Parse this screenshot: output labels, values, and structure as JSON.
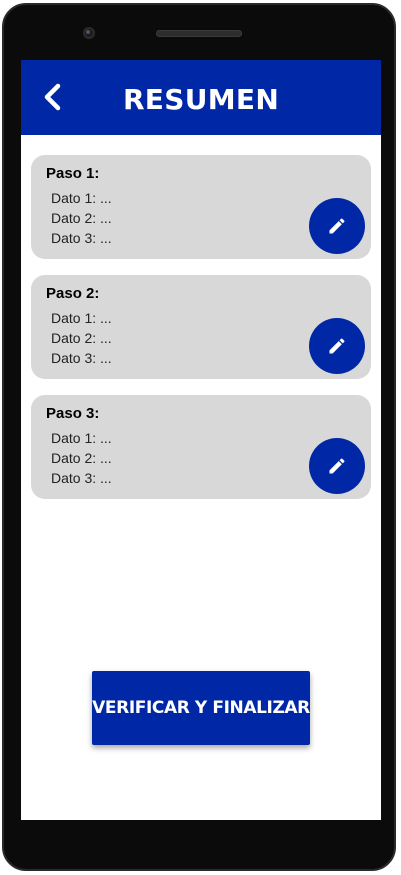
{
  "header": {
    "title": "RESUMEN",
    "back_icon": "chevron-left-icon"
  },
  "steps": [
    {
      "title": "Paso 1:",
      "lines": [
        "Dato 1: ...",
        "Dato 2: ...",
        "Dato 3: ..."
      ],
      "edit_icon": "pencil-icon"
    },
    {
      "title": "Paso 2:",
      "lines": [
        "Dato 1: ...",
        "Dato 2: ...",
        "Dato 3: ..."
      ],
      "edit_icon": "pencil-icon"
    },
    {
      "title": "Paso 3:",
      "lines": [
        "Dato 1: ...",
        "Dato 2: ...",
        "Dato 3: ..."
      ],
      "edit_icon": "pencil-icon"
    }
  ],
  "actions": {
    "finalize_label": "VERIFICAR Y FINALIZAR"
  },
  "colors": {
    "primary": "#0028a6",
    "card_background": "#d8d8d8",
    "screen_background": "#ffffff",
    "device_frame": "#0b0b0b"
  }
}
